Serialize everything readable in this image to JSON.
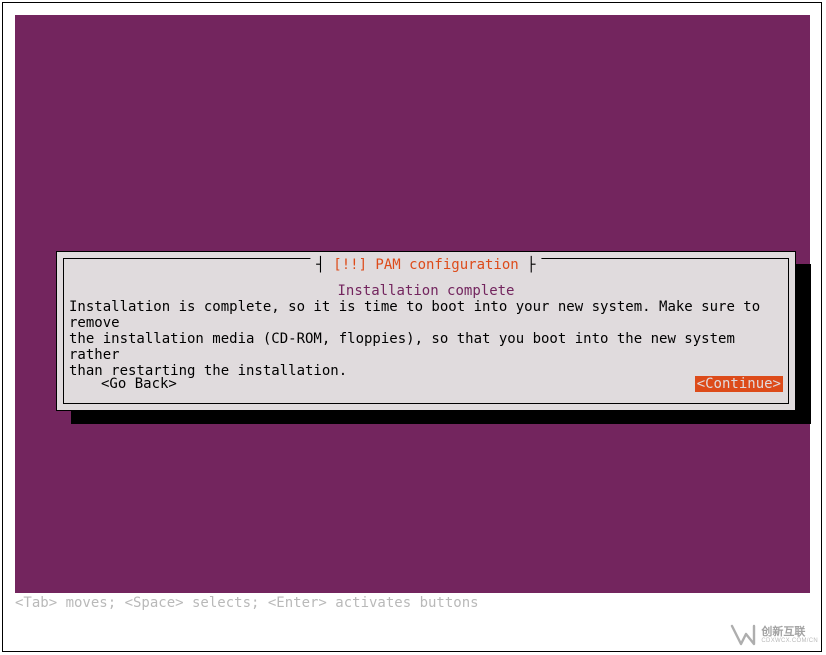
{
  "dialog": {
    "border_left": "┤ ",
    "title_mark": "[!!]",
    "title_text": " PAM configuration",
    "border_right": " ├",
    "subtitle": "Installation complete",
    "body": "Installation is complete, so it is time to boot into your new system. Make sure to remove\nthe installation media (CD-ROM, floppies), so that you boot into the new system rather\nthan restarting the installation.",
    "go_back": "<Go Back>",
    "continue": "<Continue>"
  },
  "help_bar": "<Tab> moves; <Space> selects; <Enter> activates buttons",
  "watermark": {
    "cn": "创新互联",
    "en": "CDXWCX.COM/CN"
  }
}
